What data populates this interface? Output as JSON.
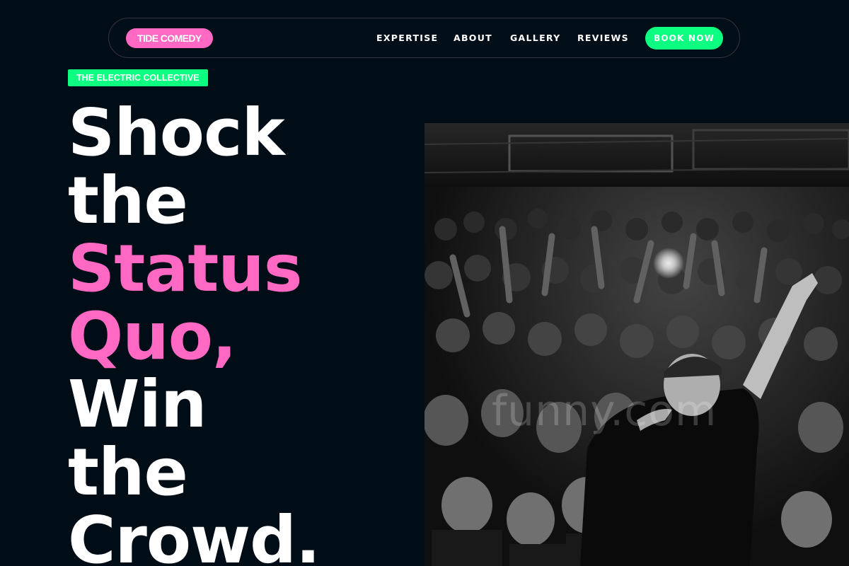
{
  "nav": {
    "logo": "TIDE COMEDY",
    "links": [
      "EXPERTISE",
      "ABOUT",
      "GALLERY",
      "REVIEWS"
    ],
    "cta": "BOOK NOW"
  },
  "hero": {
    "tag": "THE ELECTRIC COLLECTIVE",
    "headline": [
      {
        "text": "Shock",
        "accent": false
      },
      {
        "text": "the",
        "accent": false
      },
      {
        "text": "Status",
        "accent": true
      },
      {
        "text": "Quo,",
        "accent": true
      },
      {
        "text": "Win",
        "accent": false
      },
      {
        "text": "the",
        "accent": false
      },
      {
        "text": "Crowd.",
        "accent": false
      }
    ],
    "image": {
      "description_icon": "concert-crowd-photo",
      "watermark": "funny.com"
    }
  },
  "colors": {
    "background": "#010d16",
    "accent_pink": "#ff69c3",
    "accent_green": "#0cff80",
    "nav_border": "#3a3147",
    "text": "#ffffff"
  }
}
